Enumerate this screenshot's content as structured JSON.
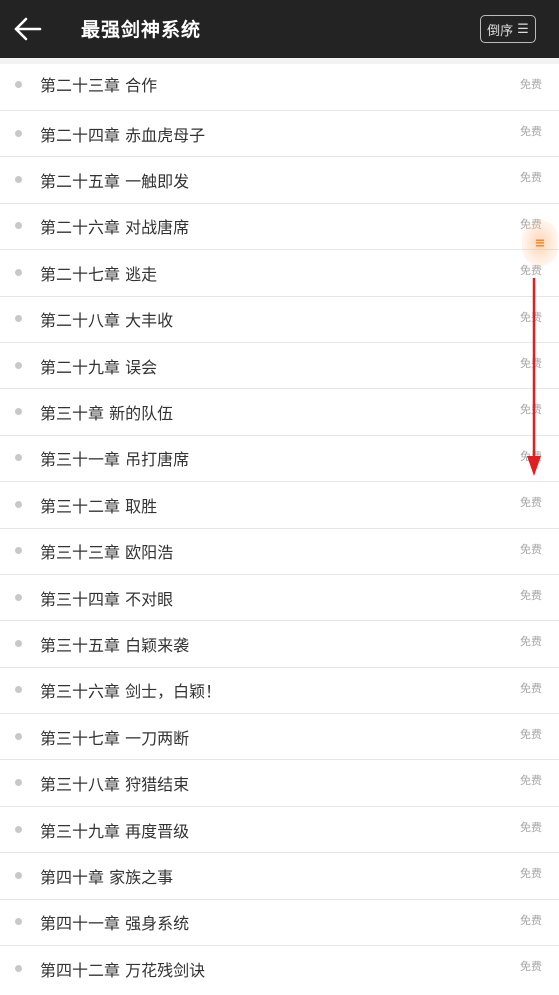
{
  "header": {
    "title": "最强剑神系统",
    "order_label": "倒序",
    "back_icon": "back-arrow-icon",
    "sort_icon": "list-sort-icon"
  },
  "chapters": [
    {
      "title": "第二十三章  合作",
      "tag": "免费"
    },
    {
      "title": "第二十四章  赤血虎母子",
      "tag": "免费"
    },
    {
      "title": "第二十五章  一触即发",
      "tag": "免费"
    },
    {
      "title": "第二十六章  对战唐席",
      "tag": "免费"
    },
    {
      "title": "第二十七章  逃走",
      "tag": "免费"
    },
    {
      "title": "第二十八章  大丰收",
      "tag": "免费"
    },
    {
      "title": "第二十九章  误会",
      "tag": "免费"
    },
    {
      "title": "第三十章  新的队伍",
      "tag": "免费"
    },
    {
      "title": "第三十一章  吊打唐席",
      "tag": "免费"
    },
    {
      "title": "第三十二章  取胜",
      "tag": "免费"
    },
    {
      "title": "第三十三章  欧阳浩",
      "tag": "免费"
    },
    {
      "title": "第三十四章  不对眼",
      "tag": "免费"
    },
    {
      "title": "第三十五章  白颖来袭",
      "tag": "免费"
    },
    {
      "title": "第三十六章  剑士，白颖！",
      "tag": "免费"
    },
    {
      "title": "第三十七章  一刀两断",
      "tag": "免费"
    },
    {
      "title": "第三十八章  狩猎结束",
      "tag": "免费"
    },
    {
      "title": "第三十九章  再度晋级",
      "tag": "免费"
    },
    {
      "title": "第四十章  家族之事",
      "tag": "免费"
    },
    {
      "title": "第四十一章  强身系统",
      "tag": "免费"
    },
    {
      "title": "第四十二章  万花残剑诀",
      "tag": "免费"
    }
  ],
  "colors": {
    "header_bg": "#232323",
    "accent_handle": "#f08a3a",
    "annotation_arrow": "#e02020"
  }
}
